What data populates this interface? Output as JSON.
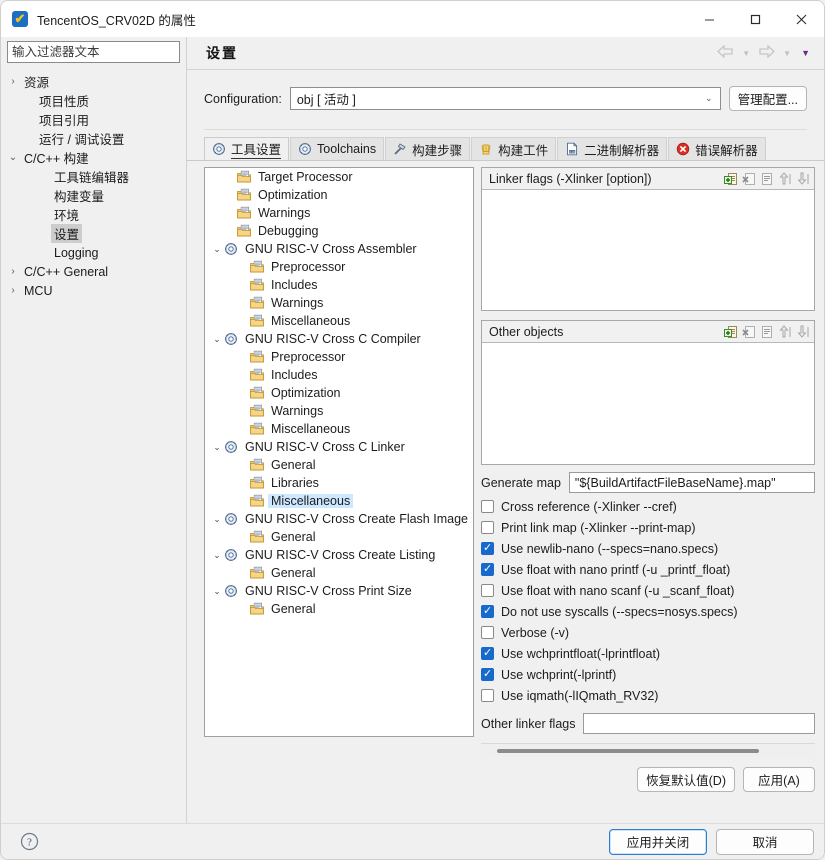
{
  "window": {
    "title": "TencentOS_CRV02D 的属性",
    "app_icon": "checkmark-badge-icon",
    "minimize": "—",
    "maximize": "□",
    "close": "✕"
  },
  "filter": {
    "placeholder": "输入过滤器文本",
    "value": ""
  },
  "sidebar": {
    "items": [
      {
        "label": "资源",
        "twisty": "collapsed",
        "indent": 0,
        "selected": false
      },
      {
        "label": "项目性质",
        "twisty": "none",
        "indent": 1,
        "selected": false
      },
      {
        "label": "项目引用",
        "twisty": "none",
        "indent": 1,
        "selected": false
      },
      {
        "label": "运行 / 调试设置",
        "twisty": "none",
        "indent": 1,
        "selected": false
      },
      {
        "label": "C/C++ 构建",
        "twisty": "expanded",
        "indent": 0,
        "selected": false
      },
      {
        "label": "工具链编辑器",
        "twisty": "none",
        "indent": 2,
        "selected": false
      },
      {
        "label": "构建变量",
        "twisty": "none",
        "indent": 2,
        "selected": false
      },
      {
        "label": "环境",
        "twisty": "none",
        "indent": 2,
        "selected": false
      },
      {
        "label": "设置",
        "twisty": "none",
        "indent": 2,
        "selected": true
      },
      {
        "label": "Logging",
        "twisty": "none",
        "indent": 2,
        "selected": false
      },
      {
        "label": "C/C++ General",
        "twisty": "collapsed",
        "indent": 0,
        "selected": false
      },
      {
        "label": "MCU",
        "twisty": "collapsed",
        "indent": 0,
        "selected": false
      }
    ]
  },
  "page": {
    "title": "设置",
    "nav": {
      "back": "back-arrow-icon",
      "back_menu": "chevron-down-icon",
      "forward": "forward-arrow-icon",
      "forward_menu": "chevron-down-icon",
      "view_menu": "chevron-down-icon"
    }
  },
  "configuration": {
    "label": "Configuration:",
    "value": "obj [ 活动 ]",
    "manage_button": "管理配置..."
  },
  "tabs": [
    {
      "label": "工具设置",
      "icon": "wrench-gear-icon",
      "active": true
    },
    {
      "label": "Toolchains",
      "icon": "wrench-gear-icon",
      "active": false
    },
    {
      "label": "构建步骤",
      "icon": "hammer-icon",
      "active": false
    },
    {
      "label": "构建工件",
      "icon": "artifact-icon",
      "active": false
    },
    {
      "label": "二进制解析器",
      "icon": "binary-file-icon",
      "active": false
    },
    {
      "label": "错误解析器",
      "icon": "error-circle-icon",
      "active": false
    }
  ],
  "tool_tree": [
    {
      "label": "Target Processor",
      "twisty": "none",
      "indent": 1,
      "icon": "folder-page-icon",
      "selected": false
    },
    {
      "label": "Optimization",
      "twisty": "none",
      "indent": 1,
      "icon": "folder-page-icon",
      "selected": false
    },
    {
      "label": "Warnings",
      "twisty": "none",
      "indent": 1,
      "icon": "folder-page-icon",
      "selected": false
    },
    {
      "label": "Debugging",
      "twisty": "none",
      "indent": 1,
      "icon": "folder-page-icon",
      "selected": false
    },
    {
      "label": "GNU RISC-V Cross Assembler",
      "twisty": "expanded",
      "indent": 0,
      "icon": "tool-gear-icon",
      "selected": false
    },
    {
      "label": "Preprocessor",
      "twisty": "none",
      "indent": 2,
      "icon": "folder-page-icon",
      "selected": false
    },
    {
      "label": "Includes",
      "twisty": "none",
      "indent": 2,
      "icon": "folder-page-icon",
      "selected": false
    },
    {
      "label": "Warnings",
      "twisty": "none",
      "indent": 2,
      "icon": "folder-page-icon",
      "selected": false
    },
    {
      "label": "Miscellaneous",
      "twisty": "none",
      "indent": 2,
      "icon": "folder-page-icon",
      "selected": false
    },
    {
      "label": "GNU RISC-V Cross C Compiler",
      "twisty": "expanded",
      "indent": 0,
      "icon": "tool-gear-icon",
      "selected": false
    },
    {
      "label": "Preprocessor",
      "twisty": "none",
      "indent": 2,
      "icon": "folder-page-icon",
      "selected": false
    },
    {
      "label": "Includes",
      "twisty": "none",
      "indent": 2,
      "icon": "folder-page-icon",
      "selected": false
    },
    {
      "label": "Optimization",
      "twisty": "none",
      "indent": 2,
      "icon": "folder-page-icon",
      "selected": false
    },
    {
      "label": "Warnings",
      "twisty": "none",
      "indent": 2,
      "icon": "folder-page-icon",
      "selected": false
    },
    {
      "label": "Miscellaneous",
      "twisty": "none",
      "indent": 2,
      "icon": "folder-page-icon",
      "selected": false
    },
    {
      "label": "GNU RISC-V Cross C Linker",
      "twisty": "expanded",
      "indent": 0,
      "icon": "tool-gear-icon",
      "selected": false
    },
    {
      "label": "General",
      "twisty": "none",
      "indent": 2,
      "icon": "folder-page-icon",
      "selected": false
    },
    {
      "label": "Libraries",
      "twisty": "none",
      "indent": 2,
      "icon": "folder-page-icon",
      "selected": false
    },
    {
      "label": "Miscellaneous",
      "twisty": "none",
      "indent": 2,
      "icon": "folder-page-icon",
      "selected": true
    },
    {
      "label": "GNU RISC-V Cross Create Flash Image",
      "twisty": "expanded",
      "indent": 0,
      "icon": "tool-gear-icon",
      "selected": false
    },
    {
      "label": "General",
      "twisty": "none",
      "indent": 2,
      "icon": "folder-page-icon",
      "selected": false
    },
    {
      "label": "GNU RISC-V Cross Create Listing",
      "twisty": "expanded",
      "indent": 0,
      "icon": "tool-gear-icon",
      "selected": false
    },
    {
      "label": "General",
      "twisty": "none",
      "indent": 2,
      "icon": "folder-page-icon",
      "selected": false
    },
    {
      "label": "GNU RISC-V Cross Print Size",
      "twisty": "expanded",
      "indent": 0,
      "icon": "tool-gear-icon",
      "selected": false
    },
    {
      "label": "General",
      "twisty": "none",
      "indent": 2,
      "icon": "folder-page-icon",
      "selected": false
    }
  ],
  "groups": [
    {
      "title": "Linker flags (-Xlinker [option])",
      "items": [],
      "tools": [
        "add-icon",
        "delete-icon",
        "edit-icon",
        "move-up-icon",
        "move-down-icon"
      ]
    },
    {
      "title": "Other objects",
      "items": [],
      "tools": [
        "add-icon",
        "delete-icon",
        "edit-icon",
        "move-up-icon",
        "move-down-icon"
      ]
    }
  ],
  "fields": {
    "generate_map_label": "Generate map",
    "generate_map_value": "\"${BuildArtifactFileBaseName}.map\"",
    "other_linker_flags_label": "Other linker flags",
    "other_linker_flags_value": ""
  },
  "checkboxes": [
    {
      "label": "Cross reference (-Xlinker --cref)",
      "checked": false
    },
    {
      "label": "Print link map (-Xlinker --print-map)",
      "checked": false
    },
    {
      "label": "Use newlib-nano (--specs=nano.specs)",
      "checked": true
    },
    {
      "label": "Use float with nano printf (-u _printf_float)",
      "checked": true
    },
    {
      "label": "Use float with nano scanf (-u _scanf_float)",
      "checked": false
    },
    {
      "label": "Do not use syscalls (--specs=nosys.specs)",
      "checked": true
    },
    {
      "label": "Verbose (-v)",
      "checked": false
    },
    {
      "label": "Use wchprintfloat(-lprintfloat)",
      "checked": true
    },
    {
      "label": "Use wchprint(-lprintf)",
      "checked": true
    },
    {
      "label": "Use iqmath(-lIQmath_RV32)",
      "checked": false
    }
  ],
  "panel_buttons": {
    "restore_defaults": "恢复默认值(D)",
    "apply": "应用(A)"
  },
  "footer": {
    "help_icon": "help-circle-icon",
    "apply_and_close": "应用并关闭",
    "cancel": "取消"
  },
  "colors": {
    "accent": "#1769cc",
    "selection": "#cde8ff",
    "sidebar_selection": "#cdcdcd",
    "nav_active": "#6a2a8a"
  }
}
